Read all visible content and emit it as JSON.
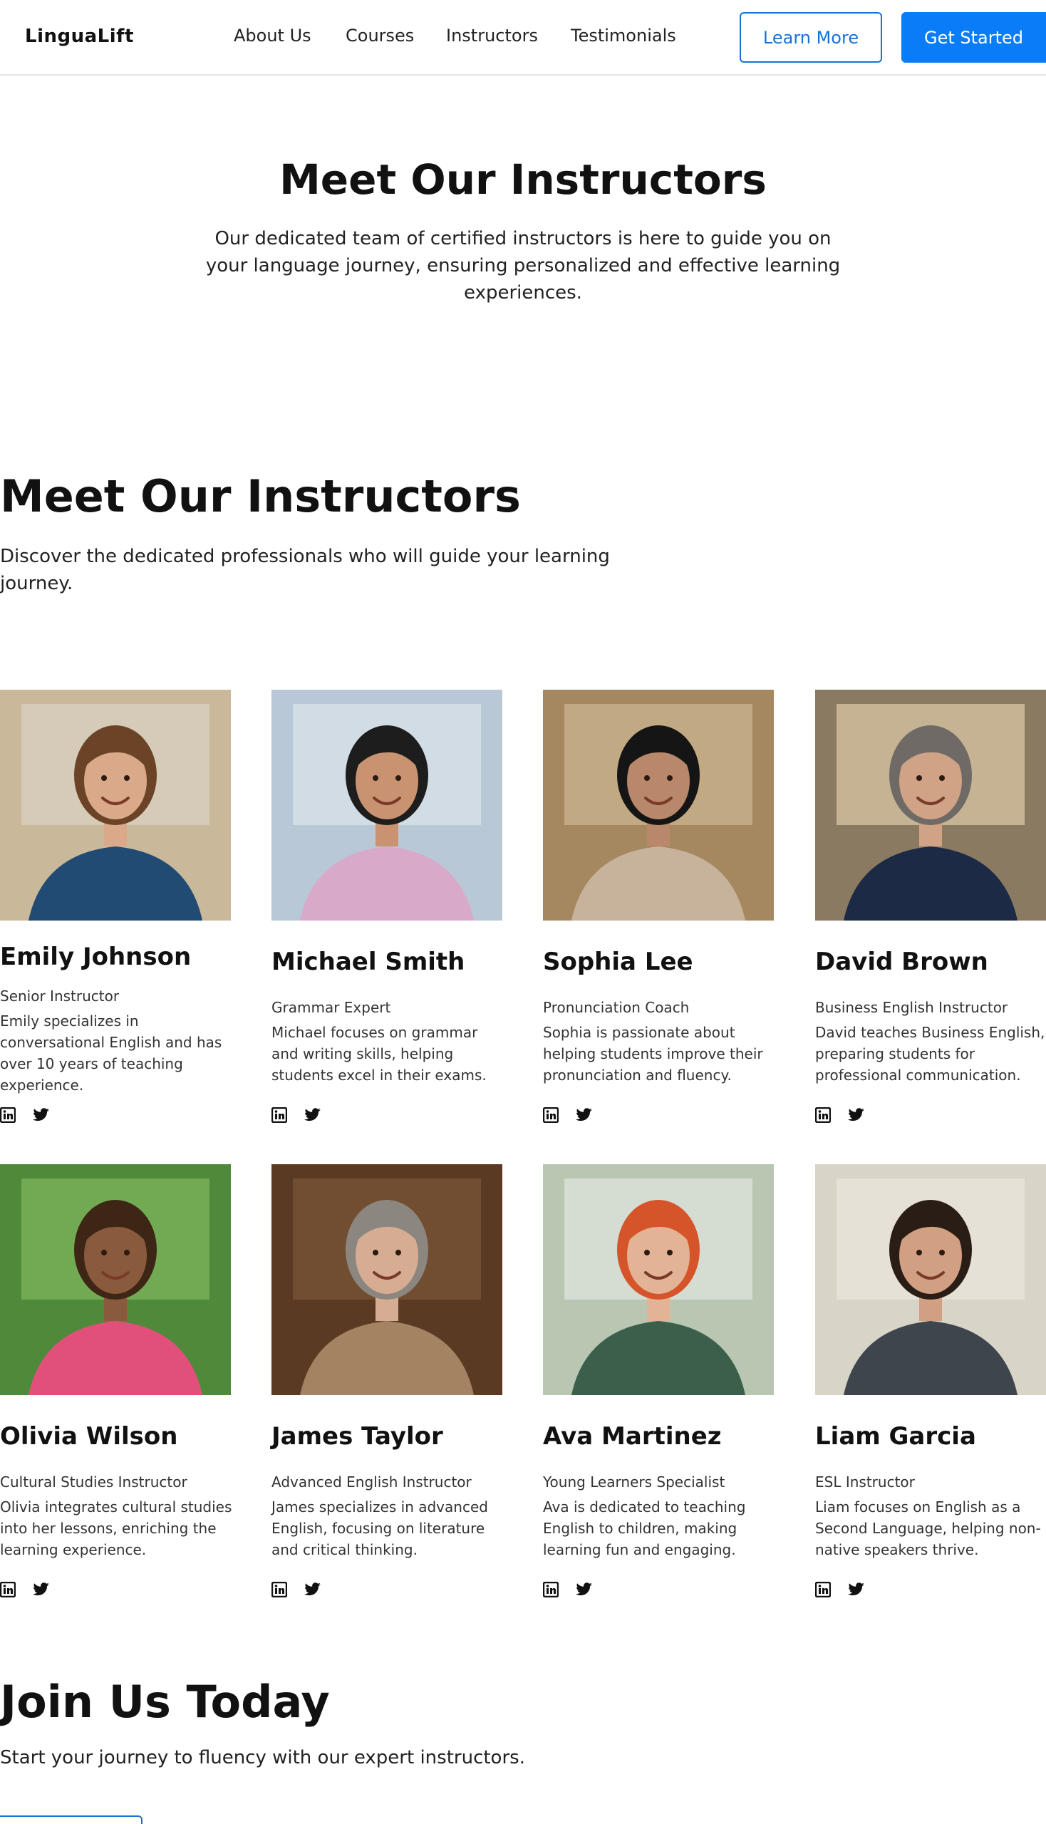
{
  "nav": {
    "logo": "LinguaLift",
    "links": [
      "About Us",
      "Courses",
      "Instructors",
      "Testimonials"
    ],
    "learn_more": "Learn More",
    "get_started": "Get Started"
  },
  "hero": {
    "title": "Meet Our Instructors",
    "subtitle": "Our dedicated team of certified instructors is here to guide you on your language journey, ensuring personalized and effective learning experiences."
  },
  "instructors_section": {
    "title": "Meet Our Instructors",
    "subtitle": "Discover the dedicated professionals who will guide your learning journey."
  },
  "instructors": [
    {
      "name": "Emily Johnson",
      "role": "Senior Instructor",
      "bio": "Emily specializes in conversational English and has over 10 years of teaching experience."
    },
    {
      "name": "Michael Smith",
      "role": "Grammar Expert",
      "bio": "Michael focuses on grammar and writing skills, helping students excel in their exams."
    },
    {
      "name": "Sophia Lee",
      "role": "Pronunciation Coach",
      "bio": "Sophia is passionate about helping students improve their pronunciation and fluency."
    },
    {
      "name": "David Brown",
      "role": "Business English Instructor",
      "bio": "David teaches Business English, preparing students for professional communication."
    },
    {
      "name": "Olivia Wilson",
      "role": "Cultural Studies Instructor",
      "bio": "Olivia integrates cultural studies into her lessons, enriching the learning experience."
    },
    {
      "name": "James Taylor",
      "role": "Advanced English Instructor",
      "bio": "James specializes in advanced English, focusing on literature and critical thinking."
    },
    {
      "name": "Ava Martinez",
      "role": "Young Learners Specialist",
      "bio": "Ava is dedicated to teaching English to children, making learning fun and engaging."
    },
    {
      "name": "Liam Garcia",
      "role": "ESL Instructor",
      "bio": "Liam focuses on English as a Second Language, helping non-native speakers thrive."
    }
  ],
  "social_icons": [
    "linkedin-icon",
    "twitter-icon"
  ],
  "join": {
    "title": "Join Us Today",
    "subtitle": "Start your journey to fluency with our expert instructors."
  },
  "colors": {
    "primary": "#0a7cf7",
    "outline": "#1673d4",
    "text": "#111111"
  }
}
